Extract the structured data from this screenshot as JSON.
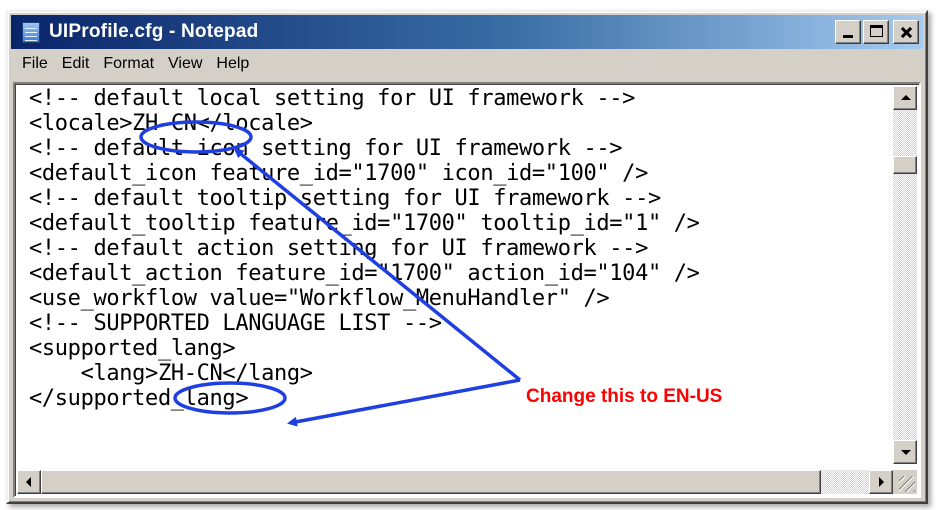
{
  "window": {
    "title": "UIProfile.cfg - Notepad",
    "icon": "notepad-icon",
    "controls": [
      "minimize-icon",
      "maximize-icon",
      "close-icon"
    ]
  },
  "menu": {
    "items": [
      "File",
      "Edit",
      "Format",
      "View",
      "Help"
    ]
  },
  "document": {
    "lines": [
      "<!-- default local setting for UI framework -->",
      "<locale>ZH-CN</locale>",
      "<!-- default icon setting for UI framework -->",
      "<default_icon feature_id=\"1700\" icon_id=\"100\" />",
      "<!-- default tooltip setting for UI framework -->",
      "<default_tooltip feature_id=\"1700\" tooltip_id=\"1\" />",
      "<!-- default action setting for UI framework -->",
      "<default_action feature_id=\"1700\" action_id=\"104\" />",
      "<use_workflow value=\"Workflow_MenuHandler\" />",
      "<!-- SUPPORTED LANGUAGE LIST -->",
      "<supported_lang>",
      "    <lang>ZH-CN</lang>",
      "</supported_lang>"
    ]
  },
  "annotation": {
    "text": "Change this to EN-US",
    "color": "#ff0000",
    "arrow_color": "#1f3fe0"
  },
  "colors": {
    "titlebar_start": "#0a246a",
    "titlebar_end": "#a6caf0",
    "face": "#d4d0c8"
  }
}
